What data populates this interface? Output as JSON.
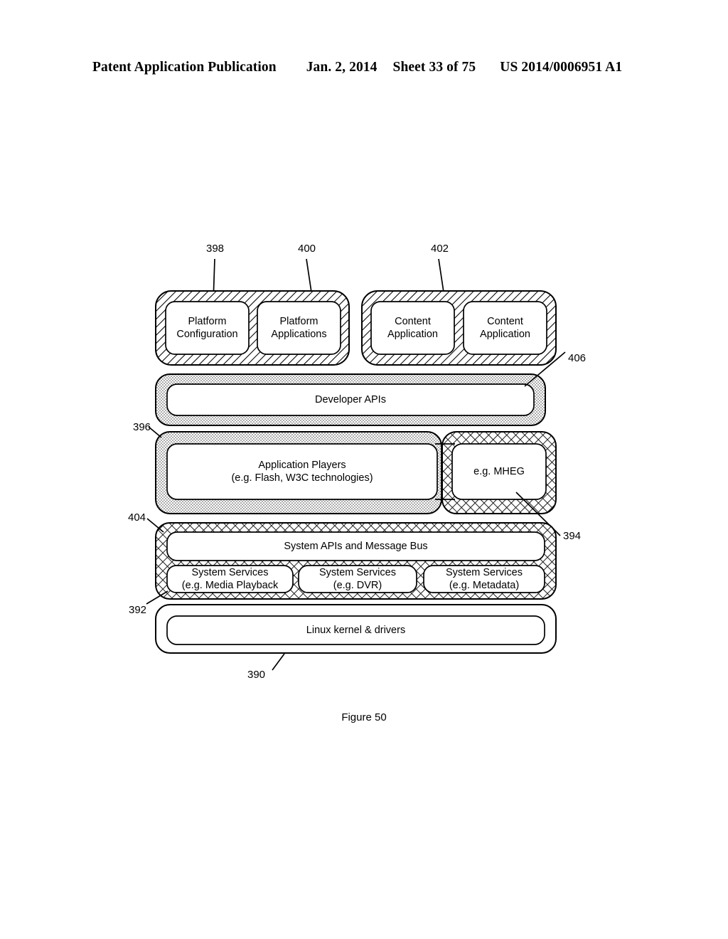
{
  "header": {
    "publication": "Patent Application Publication",
    "date": "Jan. 2, 2014",
    "sheet": "Sheet 33 of 75",
    "patent_number": "US 2014/0006951 A1"
  },
  "figure": {
    "caption": "Figure 50"
  },
  "diagram": {
    "platform_group": {
      "boxes": [
        {
          "label": "Platform\nConfiguration",
          "ref": "398"
        },
        {
          "label": "Platform\nApplications",
          "ref": "400"
        }
      ]
    },
    "content_group": {
      "boxes": [
        {
          "label": "Content\nApplication",
          "ref": "402"
        },
        {
          "label": "Content\nApplication",
          "ref": ""
        }
      ]
    },
    "developer_apis": {
      "label": "Developer APIs",
      "ref": "406"
    },
    "application_players": {
      "label": "Application Players\n(e.g. Flash, W3C technologies)",
      "ref": "396"
    },
    "mheg": {
      "label": "e.g. MHEG",
      "ref": "394"
    },
    "system_apis": {
      "label": "System APIs and Message Bus",
      "ref": "404"
    },
    "system_services": [
      {
        "label": "System Services\n(e.g. Media Playback"
      },
      {
        "label": "System Services\n(e.g. DVR)"
      },
      {
        "label": "System Services\n(e.g. Metadata)"
      }
    ],
    "system_services_ref": "392",
    "kernel": {
      "label": "Linux kernel & drivers",
      "ref": "390"
    },
    "colors": {
      "stroke": "#000000",
      "fill_white": "#ffffff",
      "hatch_diagonal": "#000000",
      "hatch_dot": "#4a4a4a",
      "hatch_cross": "#2b2b2b"
    }
  }
}
